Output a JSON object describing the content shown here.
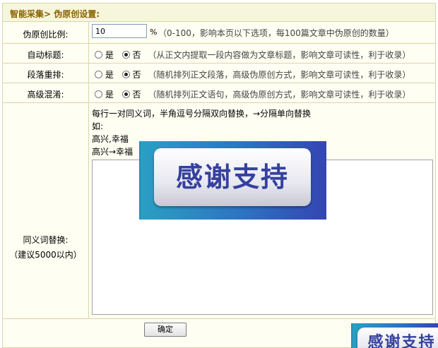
{
  "header": {
    "title": "智能采集> 伪原创设置:"
  },
  "ratio": {
    "label": "伪原创比例:",
    "value": "10",
    "unit": "%",
    "hint": "（0-100，影响本页以下选项，每100篇文章中伪原创的数量）"
  },
  "auto_title": {
    "label": "自动标题:",
    "yes": "是",
    "no": "否",
    "selected": "否",
    "hint": "（从正文内提取一段内容做为文章标题，影响文章可读性，利于收录）"
  },
  "paragraph_reorder": {
    "label": "段落重排:",
    "yes": "是",
    "no": "否",
    "selected": "否",
    "hint": "（随机排列正文段落，高级伪原创方式，影响文章可读性，利于收录）"
  },
  "advanced_shuffle": {
    "label": "高级混淆:",
    "yes": "是",
    "no": "否",
    "selected": "否",
    "hint": "（随机排列正文语句，高级伪原创方式，影响文章可读性，利于收录）"
  },
  "synonyms": {
    "label": "同义词替换:",
    "sublabel": "（建议5000以内）",
    "instruction": "每行一对同义词，半角逗号分隔双向替换，→分隔单向替换",
    "example_title": "如:",
    "example_1": "高兴,幸福",
    "example_2": "高兴→幸福",
    "value": ""
  },
  "submit": {
    "label": "确定"
  },
  "overlay_banner": {
    "text": "感谢支持"
  },
  "overlay_banner_corner": {
    "text": "感谢支持"
  },
  "colors": {
    "border": "#d9d6a7",
    "title_text": "#8a6200",
    "banner_text": "#35419e",
    "banner_blue": "#2d73c3"
  }
}
